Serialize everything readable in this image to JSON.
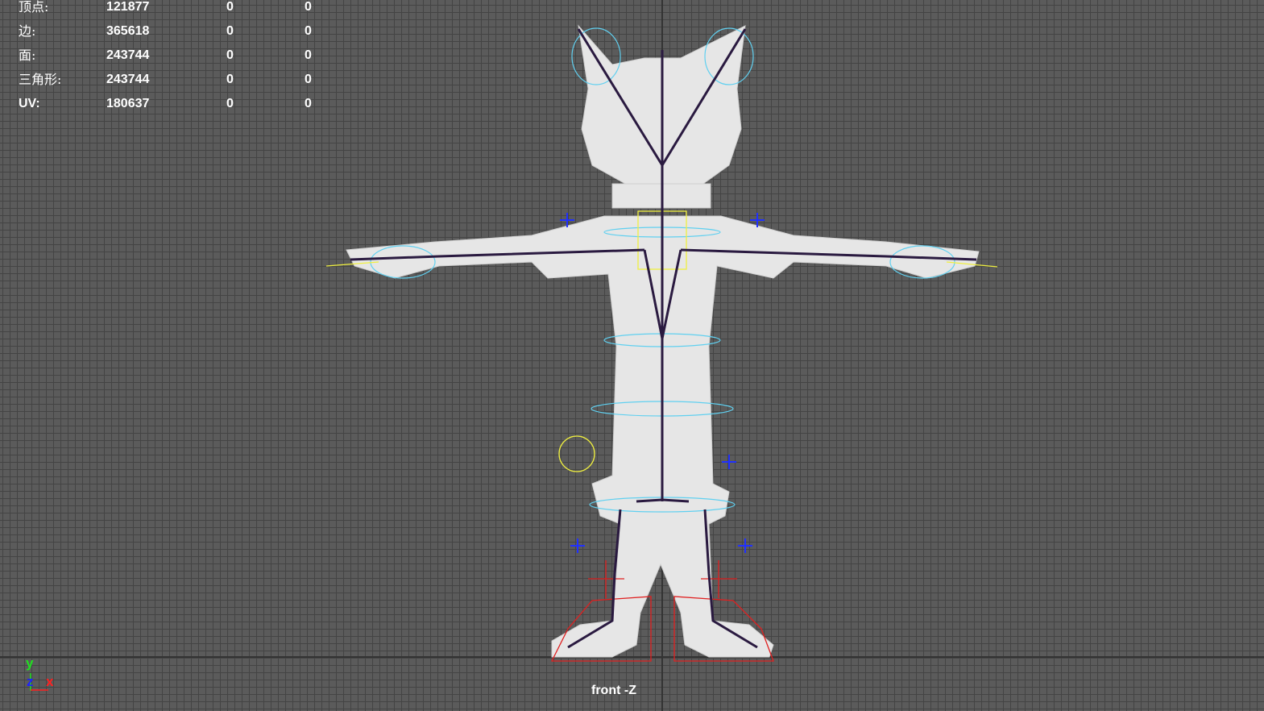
{
  "stats": [
    {
      "label": "顶点:",
      "total": "121877",
      "selected": "0",
      "other": "0"
    },
    {
      "label": "边:",
      "total": "365618",
      "selected": "0",
      "other": "0"
    },
    {
      "label": "面:",
      "total": "243744",
      "selected": "0",
      "other": "0"
    },
    {
      "label": "三角形:",
      "total": "243744",
      "selected": "0",
      "other": "0"
    },
    {
      "label": "UV:",
      "total": "180637",
      "selected": "0",
      "other": "0"
    }
  ],
  "camera_label": "front -Z",
  "axis_gizmo": {
    "y": "y",
    "z": "z",
    "x": "x",
    "colors": {
      "x": "#ff2020",
      "y": "#20e020",
      "z": "#2020ff"
    }
  },
  "colors": {
    "background": "#5b5b5b",
    "grid": "#444444",
    "mesh": "#e8e8e8",
    "joint": "#2a1a40",
    "control": "#60d0f0",
    "selected_control": "#f0f040",
    "ik": "#e02020"
  }
}
